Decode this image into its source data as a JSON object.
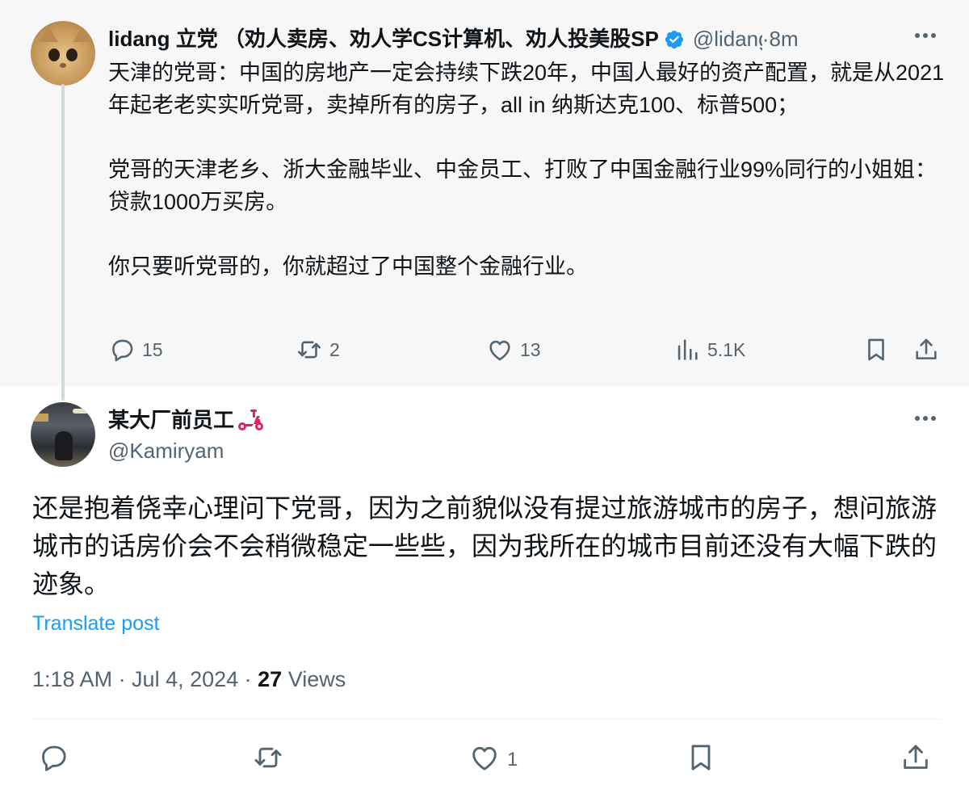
{
  "parent_tweet": {
    "author_name": "lidang 立党 （劝人卖房、劝人学CS计算机、劝人投美股SP",
    "handle": "@lidangzzz",
    "separator": "·",
    "time_ago": "8m",
    "paragraphs": [
      "天津的党哥：中国的房地产一定会持续下跌20年，中国人最好的资产配置，就是从2021年起老老实实听党哥，卖掉所有的房子，all in 纳斯达克100、标普500；",
      "党哥的天津老乡、浙大金融毕业、中金员工、打败了中国金融行业99%同行的小姐姐：贷款1000万买房。",
      "你只要听党哥的，你就超过了中国整个金融行业。"
    ],
    "actions": {
      "replies": "15",
      "reposts": "2",
      "likes": "13",
      "views": "5.1K"
    }
  },
  "reply_tweet": {
    "author_name": "某大厂前员工",
    "handle": "@Kamiryam",
    "text": "还是抱着侥幸心理问下党哥，因为之前貌似没有提过旅游城市的房子，想问旅游城市的话房价会不会稍微稳定一些些，因为我所在的城市目前还没有大幅下跌的迹象。",
    "translate_label": "Translate post",
    "timestamp": "1:18 AM · Jul 4, 2024 · ",
    "views_count": "27",
    "views_label": " Views",
    "actions": {
      "likes": "1"
    }
  },
  "colors": {
    "accent": "#1d9bf0",
    "secondary_text": "#536471",
    "parent_background": "#f7f7f7",
    "thread_line": "#cfd9de",
    "scooter": "#e0245e"
  },
  "icons": [
    "reply-icon",
    "repost-icon",
    "like-icon",
    "views-icon",
    "bookmark-icon",
    "share-icon",
    "more-icon",
    "verified-badge-icon",
    "scooter-emoji-icon"
  ]
}
